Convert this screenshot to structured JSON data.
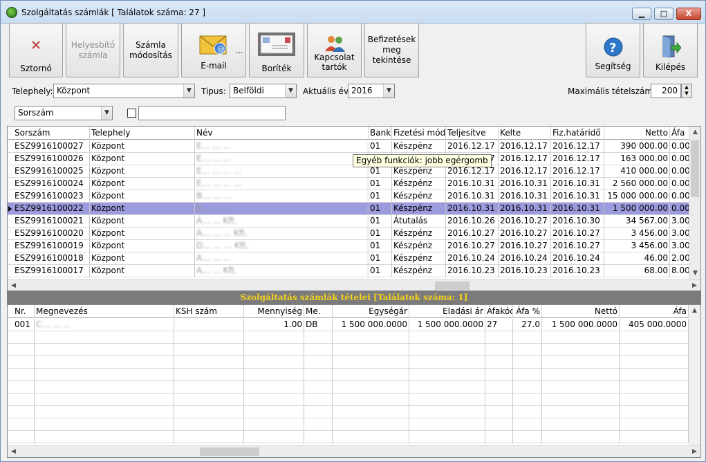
{
  "window": {
    "title": "Szolgáltatás számlák [ Találatok száma: 27 ]",
    "minimize": "▁",
    "maximize": "□",
    "close": "X"
  },
  "toolbar": {
    "storno": "Sztornó",
    "helyesbito": [
      "Helyesbítő",
      "számla"
    ],
    "modositas": [
      "Számla",
      "módosítás"
    ],
    "email": "E-mail",
    "email_more": "...",
    "boritek": "Boríték",
    "kapcsolattartok": [
      "Kapcsolat",
      "tartók"
    ],
    "befizetesek": [
      "Befizetések",
      "meg",
      "tekintése"
    ],
    "segitseg": "Segítség",
    "kilepes": "Kilépés"
  },
  "filters": {
    "telephely_label": "Telephely:",
    "telephely_value": "Központ",
    "tipus_label": "Tipus:",
    "tipus_value": "Belföldi",
    "ev_label": "Aktuális év:",
    "ev_value": "2016",
    "max_label": "Maximális tételszám:",
    "max_value": "200",
    "sort_value": "Sorszám",
    "search_value": ""
  },
  "invoices": {
    "columns": [
      "Sorszám",
      "Telephely",
      "Név",
      "Bank",
      "Fizetési mód",
      "Teljesítve",
      "Kelte",
      "Fiz.határidő",
      "Netto",
      "Áfa"
    ],
    "rows": [
      [
        "ESZ9916100027",
        "Központ",
        "E... ... ...",
        "01",
        "Készpénz",
        "2016.12.17",
        "2016.12.17",
        "2016.12.17",
        "390 000.00",
        "0.00"
      ],
      [
        "ESZ9916100026",
        "Központ",
        "E... ... ...",
        "01",
        "Készpénz",
        "2016.12.17",
        "2016.12.17",
        "2016.12.17",
        "163 000.00",
        "0.00"
      ],
      [
        "ESZ9916100025",
        "Központ",
        "E... ... ... ...",
        "01",
        "Készpénz",
        "2016.12.17",
        "2016.12.17",
        "2016.12.17",
        "410 000.00",
        "0.00"
      ],
      [
        "ESZ9916100024",
        "Központ",
        "E... ... ... ...",
        "01",
        "Készpénz",
        "2016.10.31",
        "2016.10.31",
        "2016.10.31",
        "2 560 000.00",
        "0.00"
      ],
      [
        "ESZ9916100023",
        "Központ",
        "B... ... ...",
        "01",
        "Készpénz",
        "2016.10.31",
        "2016.10.31",
        "2016.10.31",
        "15 000 000.00",
        "0.00"
      ],
      [
        "ESZ9916100022",
        "Központ",
        "B... ... ...",
        "01",
        "Készpénz",
        "2016.10.31",
        "2016.10.31",
        "2016.10.31",
        "1 500 000.00",
        "0.00"
      ],
      [
        "ESZ9916100021",
        "Központ",
        "Á... ... Kft.",
        "01",
        "Átutalás",
        "2016.10.26",
        "2016.10.27",
        "2016.10.30",
        "34 567.00",
        "3.00"
      ],
      [
        "ESZ9916100020",
        "Központ",
        "A... ... ... Kft.",
        "01",
        "Készpénz",
        "2016.10.27",
        "2016.10.27",
        "2016.10.27",
        "3 456.00",
        "3.00"
      ],
      [
        "ESZ9916100019",
        "Központ",
        "D... ... ... Kft.",
        "01",
        "Készpénz",
        "2016.10.27",
        "2016.10.27",
        "2016.10.27",
        "3 456.00",
        "3.00"
      ],
      [
        "ESZ9916100018",
        "Központ",
        "A... ... ...",
        "01",
        "Készpénz",
        "2016.10.24",
        "2016.10.24",
        "2016.10.24",
        "46.00",
        "2.00"
      ],
      [
        "ESZ9916100017",
        "Központ",
        "A... ... Kft.",
        "01",
        "Készpénz",
        "2016.10.23",
        "2016.10.23",
        "2016.10.23",
        "68.00",
        "8.00"
      ]
    ],
    "selected_index": 5,
    "tooltip": "Egyéb funkciók: jobb egérgomb"
  },
  "items": {
    "band_title": "Szolgáltatás számlák tételei [Találatok száma: 1]",
    "columns": [
      "Nr.",
      "Megnevezés",
      "KSH szám",
      "Mennyiség",
      "Me.",
      "Egységár",
      "Eladási ár",
      "Áfakód",
      "Áfa %",
      "Nettó",
      "Áfa"
    ],
    "rows": [
      [
        "001",
        "C... ... ...",
        "",
        "1.00",
        "DB",
        "1 500 000.0000",
        "1 500 000.0000",
        "27",
        "27.0",
        "1 500 000.0000",
        "405 000.0000"
      ]
    ]
  }
}
